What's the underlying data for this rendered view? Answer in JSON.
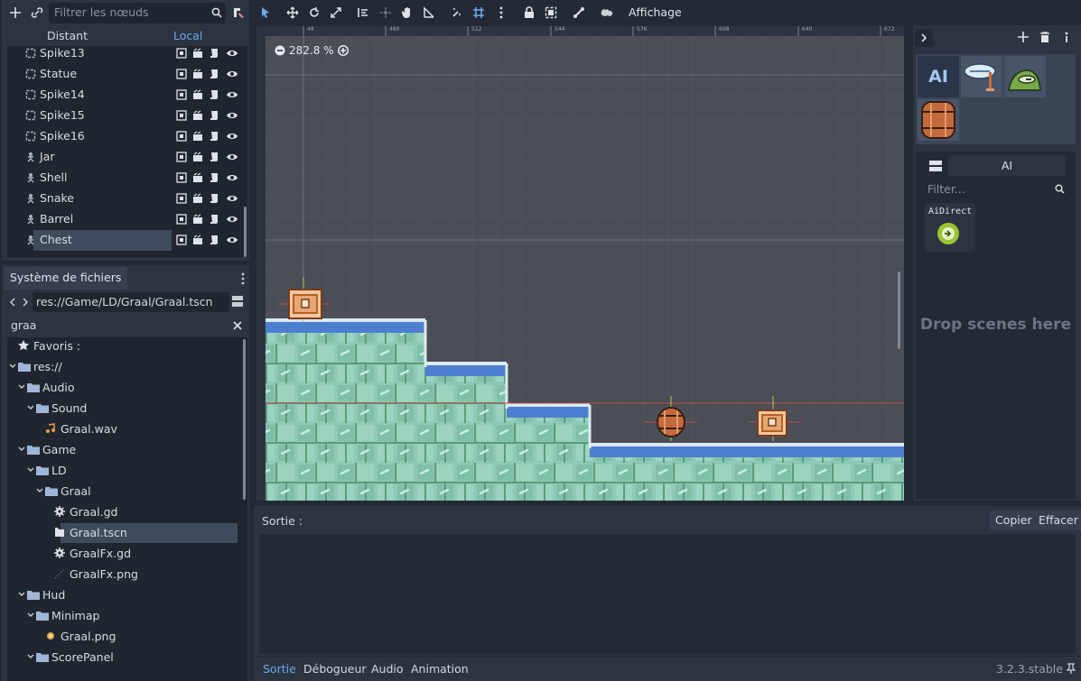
{
  "scene_dock": {
    "filter_placeholder": "Filtrer les nœuds",
    "remote_tab": "Distant",
    "local_tab": "Local",
    "nodes": [
      {
        "label": "Spike13",
        "icon": "static-body-icon"
      },
      {
        "label": "Statue",
        "icon": "static-body-icon"
      },
      {
        "label": "Spike14",
        "icon": "static-body-icon"
      },
      {
        "label": "Spike15",
        "icon": "static-body-icon"
      },
      {
        "label": "Spike16",
        "icon": "static-body-icon"
      },
      {
        "label": "Jar",
        "icon": "kinematic-body-icon"
      },
      {
        "label": "Shell",
        "icon": "kinematic-body-icon"
      },
      {
        "label": "Snake",
        "icon": "kinematic-body-icon"
      },
      {
        "label": "Barrel",
        "icon": "kinematic-body-icon"
      },
      {
        "label": "Chest",
        "icon": "kinematic-body-icon",
        "selected": true
      }
    ]
  },
  "filesystem": {
    "tab": "Système de fichiers",
    "path": "res://Game/LD/Graal/Graal.tscn",
    "search": "graa",
    "tree": [
      {
        "label": "Favoris :",
        "type": "favorites"
      },
      {
        "label": "res://",
        "type": "folder"
      },
      {
        "label": "Audio",
        "type": "folder"
      },
      {
        "label": "Sound",
        "type": "folder"
      },
      {
        "label": "Graal.wav",
        "type": "audio"
      },
      {
        "label": "Game",
        "type": "folder"
      },
      {
        "label": "LD",
        "type": "folder"
      },
      {
        "label": "Graal",
        "type": "folder"
      },
      {
        "label": "Graal.gd",
        "type": "script"
      },
      {
        "label": "Graal.tscn",
        "type": "scene",
        "selected": true
      },
      {
        "label": "GraalFx.gd",
        "type": "script"
      },
      {
        "label": "GraalFx.png",
        "type": "image"
      },
      {
        "label": "Hud",
        "type": "folder"
      },
      {
        "label": "Minimap",
        "type": "folder"
      },
      {
        "label": "Graal.png",
        "type": "image"
      },
      {
        "label": "ScorePanel",
        "type": "folder"
      }
    ]
  },
  "toolbar": {
    "view_menu": "Affichage"
  },
  "viewport": {
    "zoom": "282.8 %",
    "ruler_labels": [
      "48",
      "480",
      "512",
      "544",
      "576",
      "608",
      "640",
      "672"
    ]
  },
  "right_dock": {
    "palette_ai_label": "AI",
    "ai_header": "AI",
    "ai_filter_placeholder": "Filter...",
    "ai_item_label": "AiDirect",
    "drop_hint": "Drop scenes here"
  },
  "output": {
    "title": "Sortie :",
    "copy": "Copier",
    "clear": "Effacer"
  },
  "bottom_tabs": {
    "output": "Sortie",
    "debugger": "Débogueur",
    "audio": "Audio",
    "animation": "Animation",
    "version": "3.2.3.stable"
  },
  "colors": {
    "accent": "#6ea7ea",
    "panel": "#2c3442",
    "dark": "#20262f",
    "selected": "#3f4b5d"
  }
}
